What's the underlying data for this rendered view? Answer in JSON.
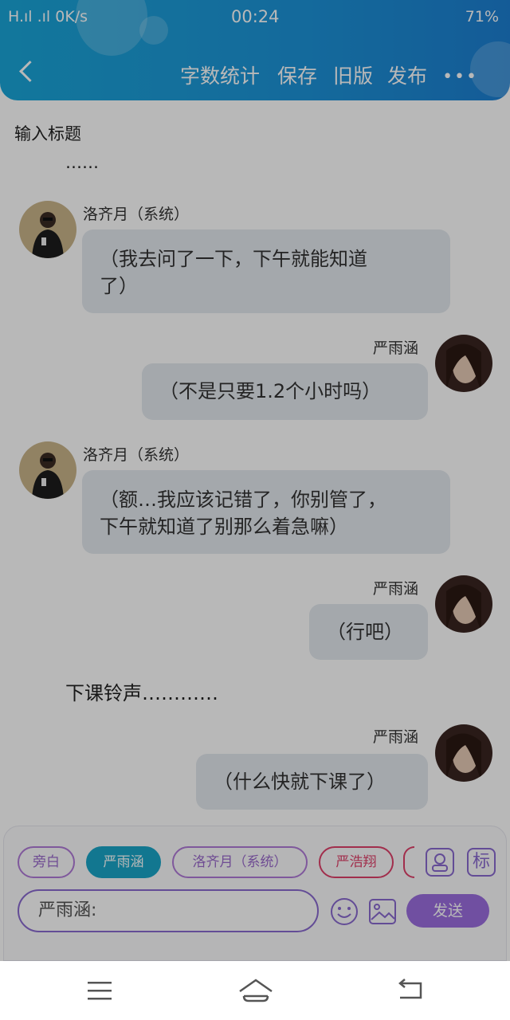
{
  "status_bar": {
    "left_text": "H.ıl .ıl 0K/s",
    "time": "00:24",
    "battery": "71%"
  },
  "header": {
    "buttons": [
      "字数统计",
      "保存",
      "旧版",
      "发布"
    ],
    "more": "•••"
  },
  "title_input": "输入标题",
  "messages": [
    {
      "type": "narration",
      "text": "……"
    },
    {
      "type": "left",
      "name": "洛齐月（系统）",
      "text_lines": [
        "（我去问了一下，下午就能知道",
        "了）"
      ]
    },
    {
      "type": "right",
      "name": "严雨涵",
      "text_lines": [
        "（不是只要1.2个小时吗）"
      ]
    },
    {
      "type": "left",
      "name": "洛齐月（系统）",
      "text_lines": [
        "（额…我应该记错了，你别管了，",
        "下午就知道了别那么着急嘛）"
      ]
    },
    {
      "type": "right",
      "name": "严雨涵",
      "text_lines": [
        "（行吧）"
      ]
    },
    {
      "type": "narration",
      "text": "下课铃声…………"
    },
    {
      "type": "right",
      "name": "严雨涵",
      "text_lines": [
        "（什么快就下课了）"
      ]
    }
  ],
  "composer": {
    "chips": [
      "旁白",
      "严雨涵",
      "洛齐月（系统）",
      "严浩翔"
    ],
    "input_value": "严雨涵:",
    "send_label": "发送",
    "tag_icon_label": "标"
  },
  "colors": {
    "header_blue": "#1d93d8",
    "purple": "#9b6ee0",
    "teal_chip": "#1aa6c8",
    "red_chip": "#e0406a"
  }
}
